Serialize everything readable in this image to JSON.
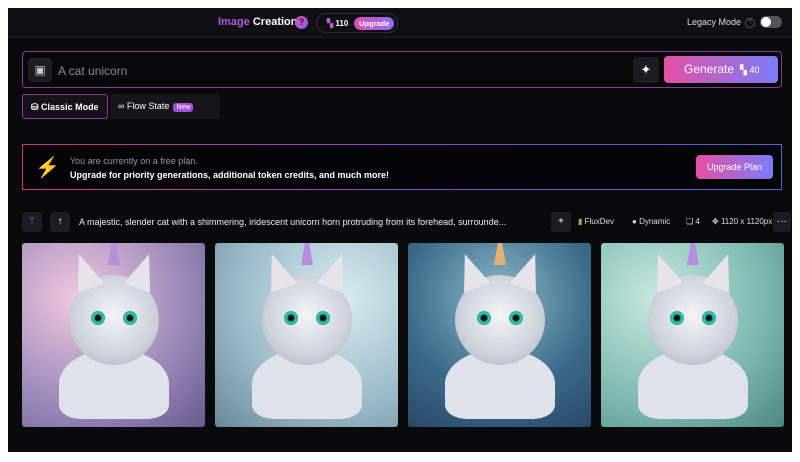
{
  "header": {
    "title_part1": "Image",
    "title_part2": "Creation",
    "help": "?",
    "tokens": "110",
    "upgrade_label": "Upgrade",
    "legacy_mode_label": "Legacy Mode",
    "legacy_mode_on": false
  },
  "prompt": {
    "placeholder": "A cat unicorn",
    "generate_label": "Generate",
    "generate_cost": "40"
  },
  "modes": {
    "classic": "Classic Mode",
    "flow": "Flow State",
    "new_badge": "New"
  },
  "banner": {
    "line1": "You are currently on a free plan.",
    "line2": "Upgrade for priority generations, additional token credits, and much more!",
    "button": "Upgrade Plan"
  },
  "generation": {
    "prompt": "A majestic, slender cat with a shimmering, iridescent unicorn horn protruding from its forehead, surrounde...",
    "model": "FluxDev",
    "style": "Dynamic",
    "count": "4",
    "size": "1120 x 1120px",
    "more": "···"
  },
  "colors": {
    "accent_pink": "#e44fa5",
    "accent_blue": "#7b7cf8",
    "background": "#0a0a0d"
  }
}
